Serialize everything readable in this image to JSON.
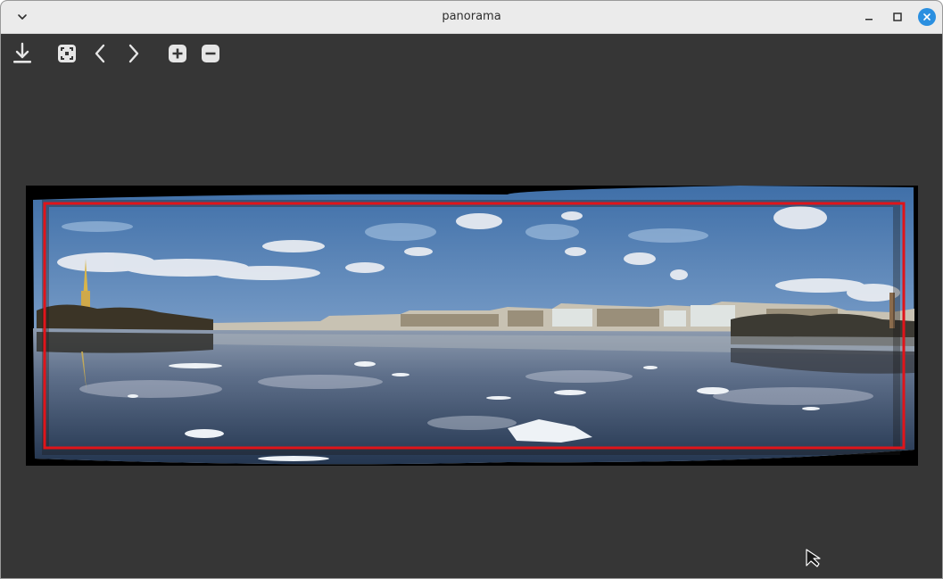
{
  "window": {
    "title": "panorama",
    "controls": [
      "chevron-down-icon",
      "minimize-icon",
      "maximize-icon",
      "close-icon"
    ],
    "accent_color": "#2a8fe0"
  },
  "toolbar": {
    "tools": [
      "download-icon",
      "fit-view-icon",
      "chevron-left-icon",
      "chevron-right-icon",
      "zoom-in-icon",
      "zoom-out-icon"
    ]
  },
  "viewer": {
    "crop_frame_color": "#e0141a",
    "background_color": "#363636"
  }
}
